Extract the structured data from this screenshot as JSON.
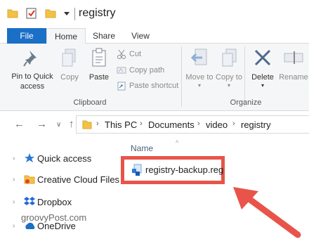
{
  "window": {
    "title": "registry"
  },
  "tabs": {
    "file": "File",
    "home": "Home",
    "share": "Share",
    "view": "View"
  },
  "ribbon": {
    "clipboard": {
      "group_label": "Clipboard",
      "pin": "Pin to Quick access",
      "copy": "Copy",
      "paste": "Paste",
      "cut": "Cut",
      "copy_path": "Copy path",
      "paste_shortcut": "Paste shortcut"
    },
    "organize": {
      "group_label": "Organize",
      "move_to": "Move to",
      "copy_to": "Copy to",
      "delete": "Delete",
      "rename": "Rename"
    }
  },
  "address": {
    "breadcrumbs": [
      "This PC",
      "Documents",
      "video",
      "registry"
    ]
  },
  "navpane": {
    "items": [
      {
        "label": "Quick access",
        "icon": "star-icon"
      },
      {
        "label": "Creative Cloud Files",
        "icon": "cloud-folder-icon"
      },
      {
        "label": "Dropbox",
        "icon": "dropbox-icon"
      },
      {
        "label": "OneDrive",
        "icon": "onedrive-icon"
      }
    ],
    "watermark": "groovyPost.com"
  },
  "filelist": {
    "column_name": "Name",
    "files": [
      {
        "name": "registry-backup.reg",
        "icon": "reg-file-icon"
      }
    ]
  },
  "colors": {
    "accent": "#1a6fc7",
    "highlight": "#e8544a",
    "folder": "#f3c145"
  }
}
